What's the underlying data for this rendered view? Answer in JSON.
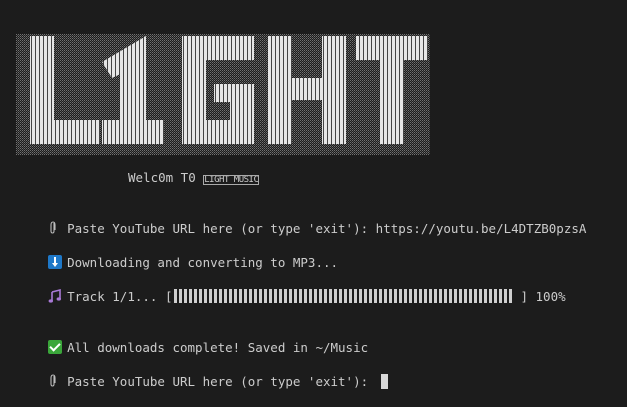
{
  "banner": {
    "text": "L1GHT"
  },
  "welcome": {
    "prefix": "Welc0m T0 ",
    "glyph_text": "LIGHT MUSIC"
  },
  "lines": {
    "prompt_label": "Paste YouTube URL here (or type 'exit'): ",
    "entered_url": "https://youtu.be/L4DTZB0pzsA",
    "downloading": "Downloading and converting to MP3...",
    "track_label": "Track 1/1... [",
    "bar_close": "]",
    "progress_text": "100%",
    "progress_fraction": 1.0,
    "complete": "All downloads complete! Saved in ~/Music",
    "prompt_label_2": "Paste YouTube URL here (or type 'exit'): "
  },
  "icons": {
    "prompt": "paperclip-icon",
    "download": "download-arrow-icon",
    "track": "music-note-icon",
    "complete": "check-mark-icon"
  },
  "colors": {
    "background": "#1c1c1c",
    "text": "#cccccc",
    "download_icon": "#1e78c8",
    "check_icon": "#3aa63a",
    "music_icon": "#a879d6"
  }
}
